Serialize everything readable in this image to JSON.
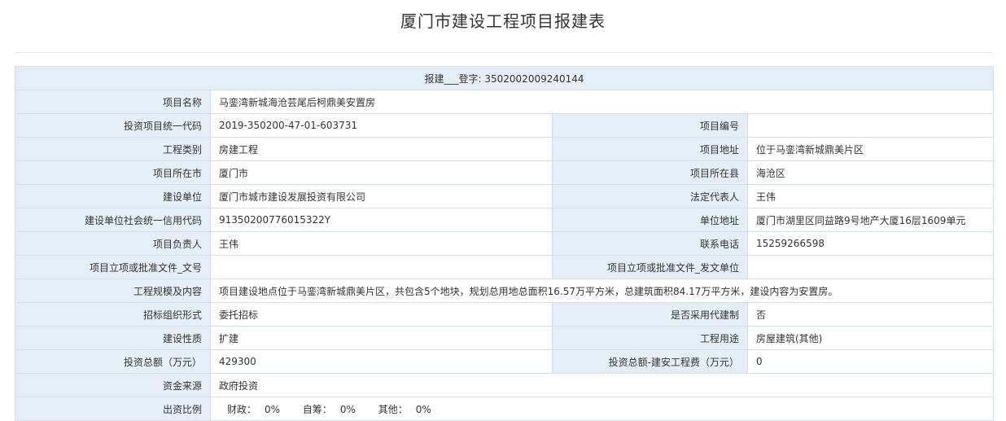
{
  "page": {
    "title": "厦门市建设工程项目报建表"
  },
  "header": {
    "reg_label": "报建___登字:",
    "reg_number": "3502002009240144"
  },
  "rows": [
    {
      "label": "项目名称",
      "value": "马銮湾新城海沧芸尾后柯鼎美安置房"
    },
    {
      "label": "投资项目统一代码",
      "value": "2019-350200-47-01-603731",
      "label2": "项目编号",
      "value2": ""
    },
    {
      "label": "工程类别",
      "value": "房建工程",
      "label2": "项目地址",
      "value2": "位于马銮湾新城鼎美片区"
    },
    {
      "label": "项目所在市",
      "value": "厦门市",
      "label2": "项目所在县",
      "value2": "海沧区"
    },
    {
      "label": "建设单位",
      "value": "厦门市城市建设发展投资有限公司",
      "label2": "法定代表人",
      "value2": "王伟"
    },
    {
      "label": "建设单位社会统一信用代码",
      "value": "91350200776015322Y",
      "label2": "单位地址",
      "value2": "厦门市湖里区同益路9号地产大厦16层1609单元"
    },
    {
      "label": "项目负责人",
      "value": "王伟",
      "label2": "联系电话",
      "value2": "15259266598"
    },
    {
      "label": "项目立项或批准文件_文号",
      "value": "",
      "label2": "项目立项或批准文件_发文单位",
      "value2": ""
    },
    {
      "label": "工程规模及内容",
      "value": "项目建设地点位于马銮湾新城鼎美片区，共包含5个地块，规划总用地总面积16.57万平方米，总建筑面积84.17万平方米，建设内容为安置房。"
    },
    {
      "label": "招标组织形式",
      "value": "委托招标",
      "label2": "是否采用代建制",
      "value2": "否"
    },
    {
      "label": "建设性质",
      "value": "扩建",
      "label2": "工程用途",
      "value2": "房屋建筑(其他)"
    },
    {
      "label": "投资总额（万元）",
      "value": "429300",
      "label2": "投资总额-建安工程费（万元）",
      "value2": "0"
    },
    {
      "label": "资金来源",
      "value": "政府投资"
    },
    {
      "label": "出资比例",
      "ratios": [
        {
          "name": "财政：",
          "value": "0%"
        },
        {
          "name": "自筹：",
          "value": "0%"
        },
        {
          "name": "其他：",
          "value": "0%"
        }
      ]
    }
  ]
}
